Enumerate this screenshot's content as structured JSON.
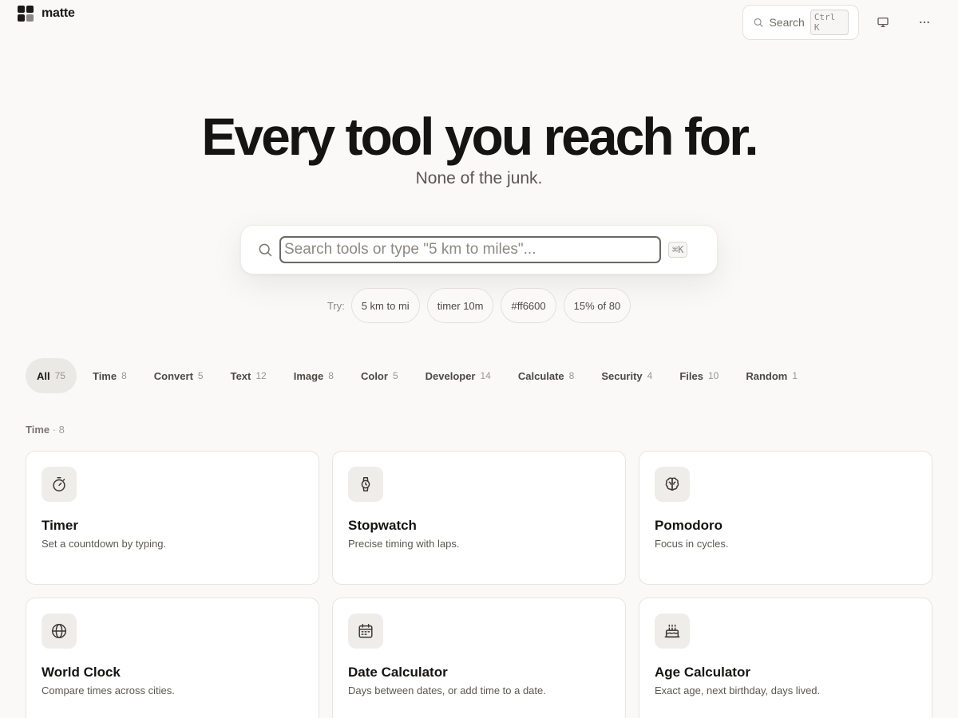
{
  "app": {
    "name": "matte"
  },
  "header": {
    "search_label": "Search",
    "search_shortcut": "Ctrl K"
  },
  "hero": {
    "title": "Every tool you reach for.",
    "subtitle": "None of the junk."
  },
  "search": {
    "placeholder": "Search tools or type \"5 km to miles\"...",
    "shortcut": "⌘K"
  },
  "try": {
    "label": "Try:",
    "examples": [
      "5 km to mi",
      "timer 10m",
      "#ff6600",
      "15% of 80"
    ]
  },
  "categories": [
    {
      "label": "All",
      "count": "75"
    },
    {
      "label": "Time",
      "count": "8"
    },
    {
      "label": "Convert",
      "count": "5"
    },
    {
      "label": "Text",
      "count": "12"
    },
    {
      "label": "Image",
      "count": "8"
    },
    {
      "label": "Color",
      "count": "5"
    },
    {
      "label": "Developer",
      "count": "14"
    },
    {
      "label": "Calculate",
      "count": "8"
    },
    {
      "label": "Security",
      "count": "4"
    },
    {
      "label": "Files",
      "count": "10"
    },
    {
      "label": "Random",
      "count": "1"
    }
  ],
  "section": {
    "title": "Time",
    "count": "· 8"
  },
  "tools": [
    {
      "title": "Timer",
      "desc": "Set a countdown by typing.",
      "icon": "timer-icon"
    },
    {
      "title": "Stopwatch",
      "desc": "Precise timing with laps.",
      "icon": "watch-icon"
    },
    {
      "title": "Pomodoro",
      "desc": "Focus in cycles.",
      "icon": "brain-icon"
    },
    {
      "title": "World Clock",
      "desc": "Compare times across cities.",
      "icon": "globe-icon"
    },
    {
      "title": "Date Calculator",
      "desc": "Days between dates, or add time to a date.",
      "icon": "calendar-icon"
    },
    {
      "title": "Age Calculator",
      "desc": "Exact age, next birthday, days lived.",
      "icon": "cake-icon"
    }
  ]
}
